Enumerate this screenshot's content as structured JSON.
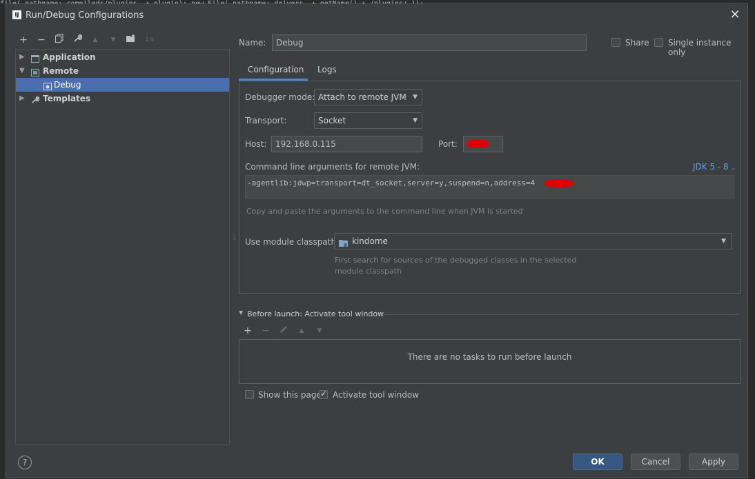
{
  "background_code": [
    "file( pathname: compileds/plugins, + plugin); new File( pathname: drivers, + getName() + /plugins/ ));"
  ],
  "window": {
    "logo": "IJ",
    "title": "Run/Debug Configurations",
    "close_icon": "close-icon"
  },
  "toolbar": {
    "add": "+",
    "remove": "−",
    "copy": "⎘",
    "edit": "🔧",
    "up": "▲",
    "down": "▼",
    "folder": "📁",
    "sort": "↓a"
  },
  "tree": {
    "items": [
      {
        "label": "Application",
        "icon": "application-icon",
        "expanded": false,
        "level": 0
      },
      {
        "label": "Remote",
        "icon": "remote-icon",
        "expanded": true,
        "level": 0
      },
      {
        "label": "Debug",
        "icon": "debug-config-icon",
        "selected": true,
        "level": 1
      },
      {
        "label": "Templates",
        "icon": "wrench-icon",
        "expanded": false,
        "level": 0
      }
    ]
  },
  "form": {
    "name_label": "Name:",
    "name_value": "Debug",
    "share_label": "Share",
    "single_instance_label": "Single instance only",
    "tabs": [
      "Configuration",
      "Logs"
    ],
    "debugger_mode_label": "Debugger mode:",
    "debugger_mode_value": "Attach to remote JVM",
    "transport_label": "Transport:",
    "transport_value": "Socket",
    "host_label": "Host:",
    "host_value": "192.168.0.115",
    "port_label": "Port:",
    "cmdline_label": "Command line arguments for remote JVM:",
    "jdk_link": "JDK 5 - 8",
    "cmdline_value": "-agentlib:jdwp=transport=dt_socket,server=y,suspend=n,address=4",
    "cmdline_hint": "Copy and paste the arguments to the command line when JVM is started",
    "module_classpath_label": "Use module classpath:",
    "module_value": "kindome",
    "module_hint_1": "First search for sources of the debugged classes in the selected",
    "module_hint_2": "module classpath"
  },
  "before_launch": {
    "header": "Before launch: Activate tool window",
    "empty_text": "There are no tasks to run before launch",
    "show_page_label": "Show this page",
    "activate_tool_label": "Activate tool window",
    "activate_checked": true
  },
  "footer": {
    "help": "?",
    "ok": "OK",
    "cancel": "Cancel",
    "apply": "Apply"
  }
}
